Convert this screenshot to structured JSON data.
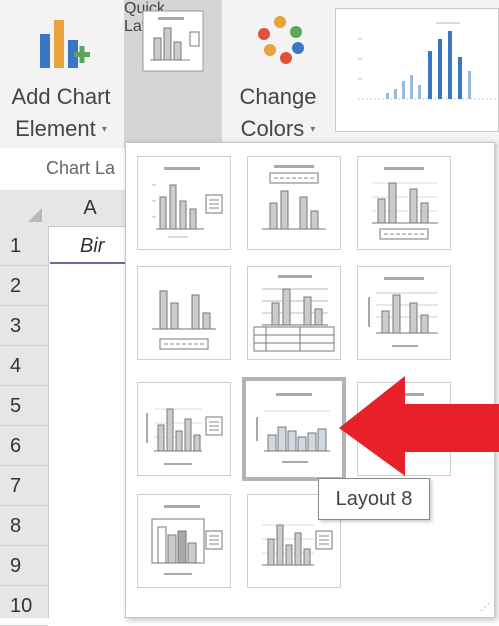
{
  "ribbon": {
    "add_chart_element": {
      "line1": "Add Chart",
      "line2": "Element"
    },
    "quick_layout": {
      "line1": "Quick",
      "line2": "Layout"
    },
    "change_colors": {
      "line1": "Change",
      "line2": "Colors"
    },
    "group_label": "Chart La"
  },
  "sheet": {
    "col_header": "A",
    "rows": [
      "1",
      "2",
      "3",
      "4",
      "5",
      "6",
      "7",
      "8",
      "9",
      "10"
    ],
    "cell_a1": "Bir"
  },
  "gallery": {
    "tooltip": "Layout 8",
    "selected_layout": "Layout 8"
  },
  "colors": {
    "arrow": "#e8202a",
    "ribbon_bg": "#f3f3f3",
    "quick_layout_bg": "#d5d5d5",
    "selection": "#7a5fb0"
  }
}
